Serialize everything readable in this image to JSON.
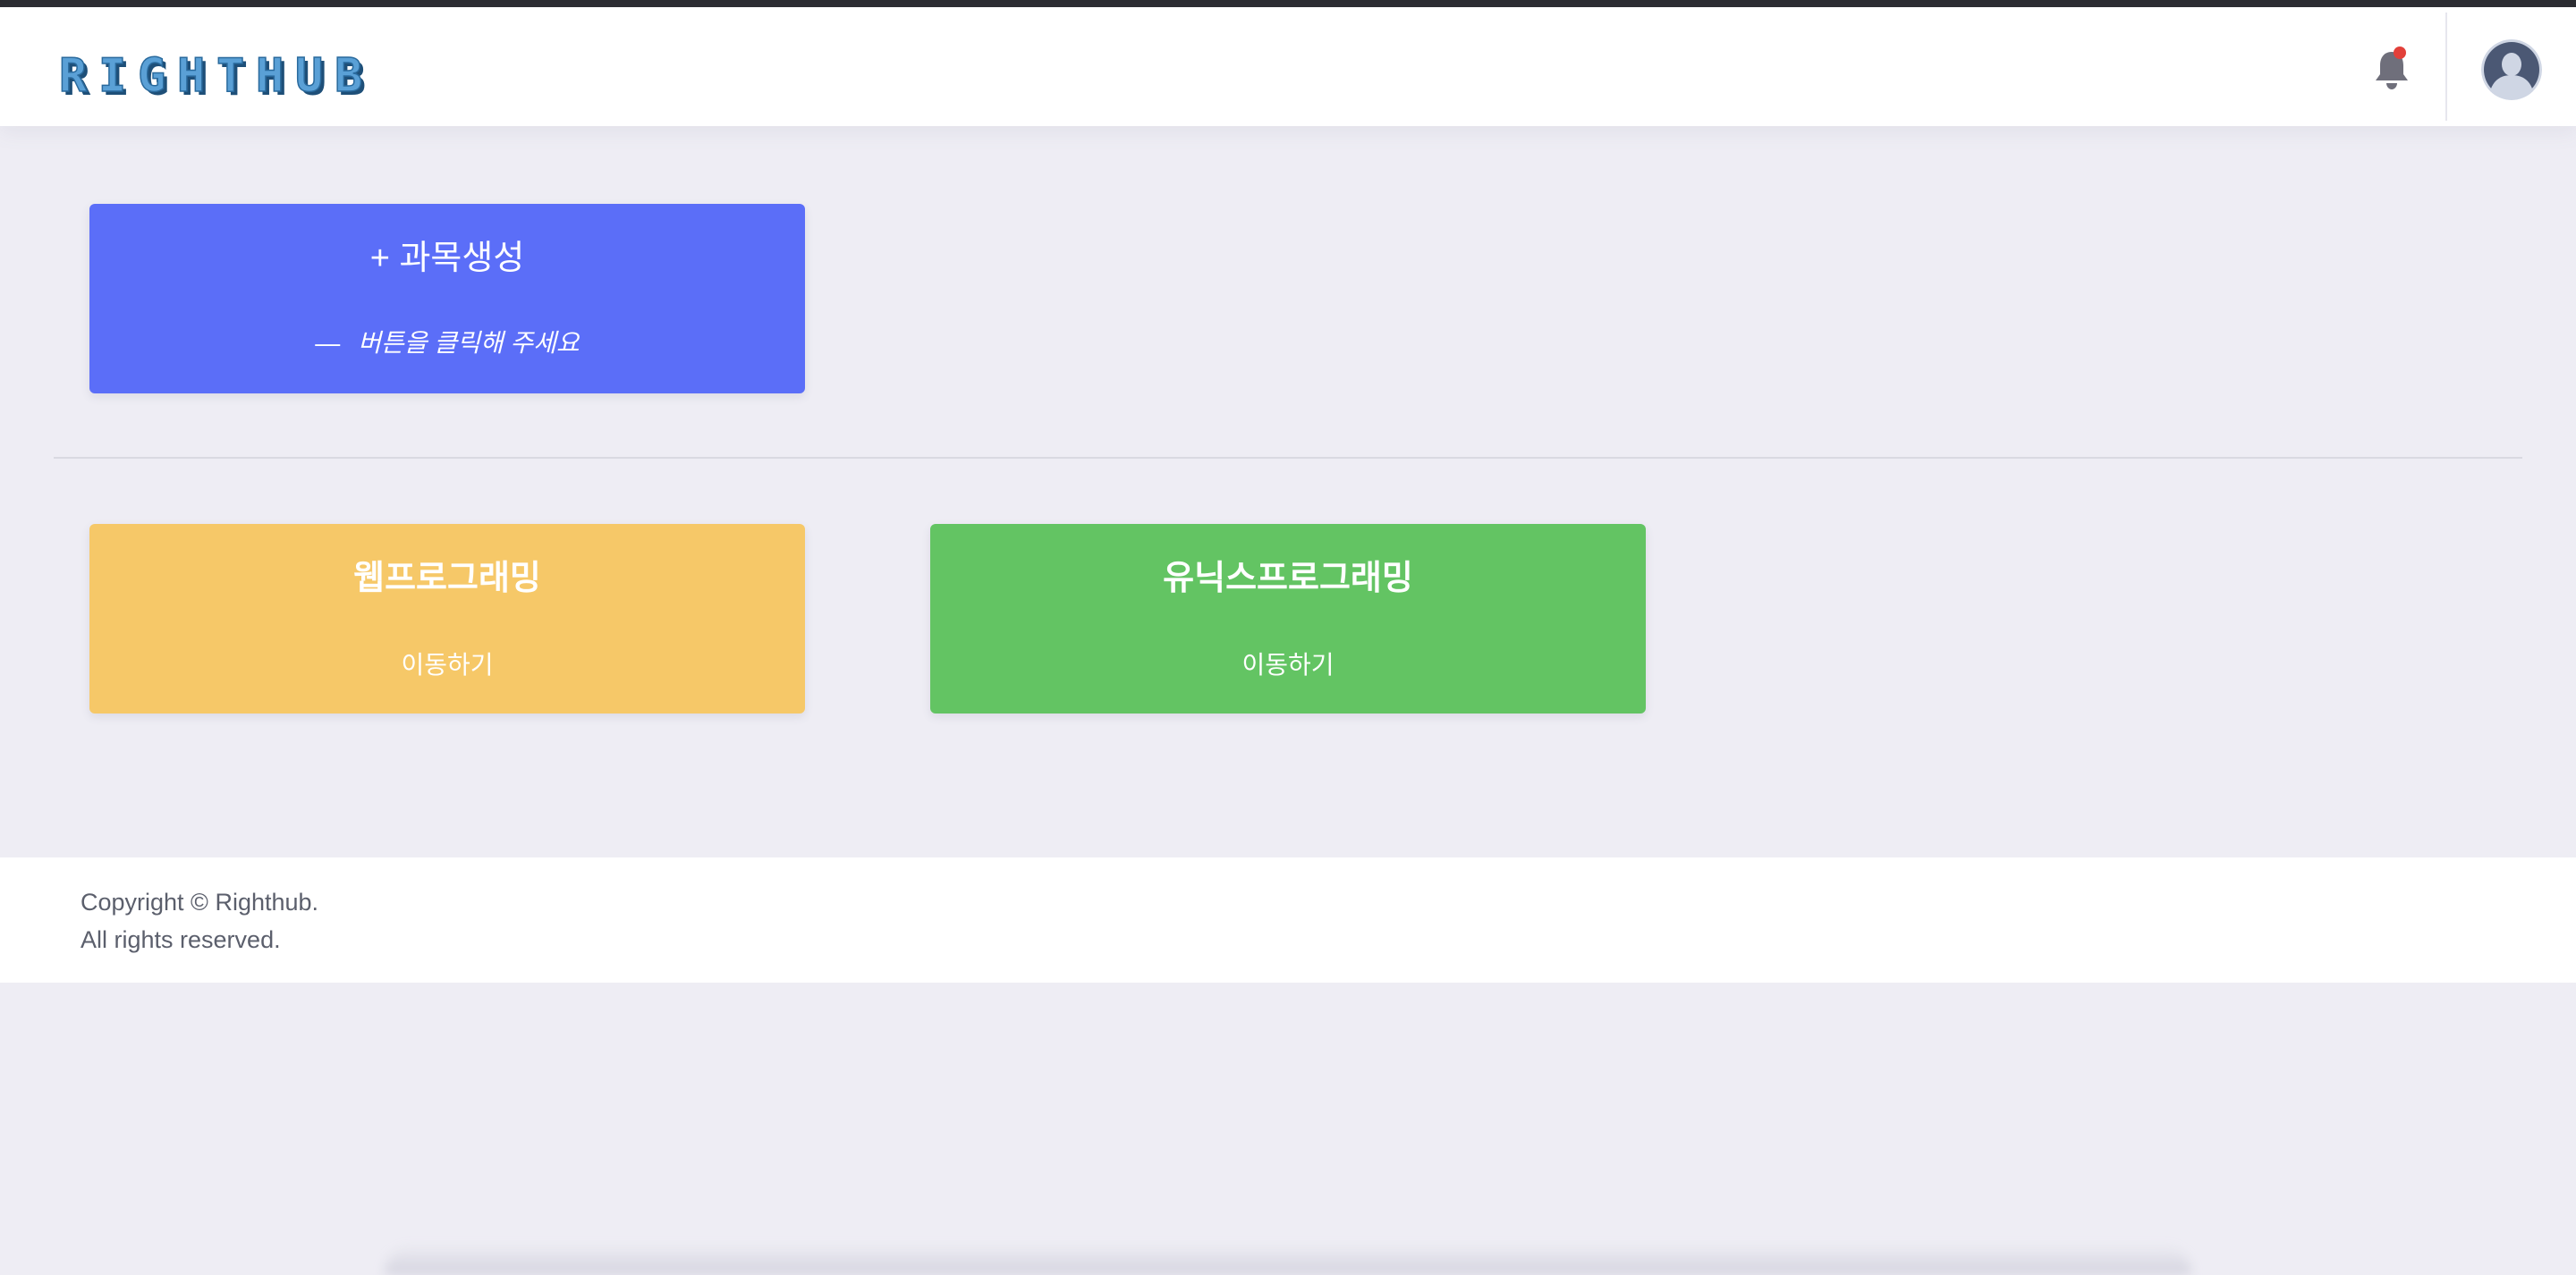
{
  "header": {
    "logo_text": "RIGHTHUB",
    "notification_dot_color": "#e2403a"
  },
  "create_card": {
    "title": "+ 과목생성",
    "dash": "—",
    "subtitle": "버튼을 클릭해 주세요",
    "color": "#5b6ef8"
  },
  "courses": [
    {
      "title": "웹프로그래밍",
      "action": "이동하기",
      "color": "#f6c868"
    },
    {
      "title": "유닉스프로그래밍",
      "action": "이동하기",
      "color": "#63c463"
    }
  ],
  "footer": {
    "line1": "Copyright © Righthub.",
    "line2": "All rights reserved."
  }
}
